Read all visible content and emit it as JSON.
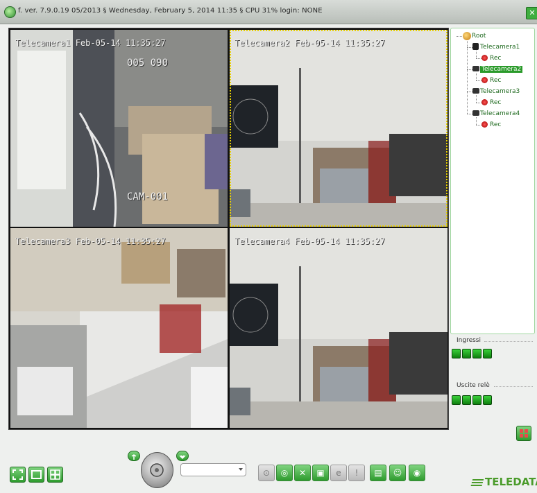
{
  "window": {
    "title_text": "f. ver. 7.9.0.19  05/2013    §   Wednesday, February 5, 2014  11:35    §  CPU 31%   login: NONE",
    "close_icon": "close-icon"
  },
  "cameras": [
    {
      "osd": "Telecamera1 Feb-05-14 11:35:27",
      "extra_top": "005   090",
      "extra_bottom": "CAM-001"
    },
    {
      "osd": "Telecamera2 Feb-05-14 11:35:27"
    },
    {
      "osd": "Telecamera3 Feb-05-14 11:35:27"
    },
    {
      "osd": "Telecamera4 Feb-05-14 11:35:27"
    }
  ],
  "tree": {
    "root": "Root",
    "items": [
      {
        "label": "Telecamera1",
        "child": "Rec"
      },
      {
        "label": "Telecamera2",
        "child": "Rec"
      },
      {
        "label": "Telecamera3",
        "child": "Rec"
      },
      {
        "label": "Telecamera4",
        "child": "Rec"
      }
    ]
  },
  "inputs_label": "Ingressi",
  "outputs_label": "Uscite relè",
  "brand": "TELEDATA",
  "colors": {
    "accent": "#2e9b2e",
    "brand": "#4a9b2a",
    "led_on": "#1faa1f"
  }
}
